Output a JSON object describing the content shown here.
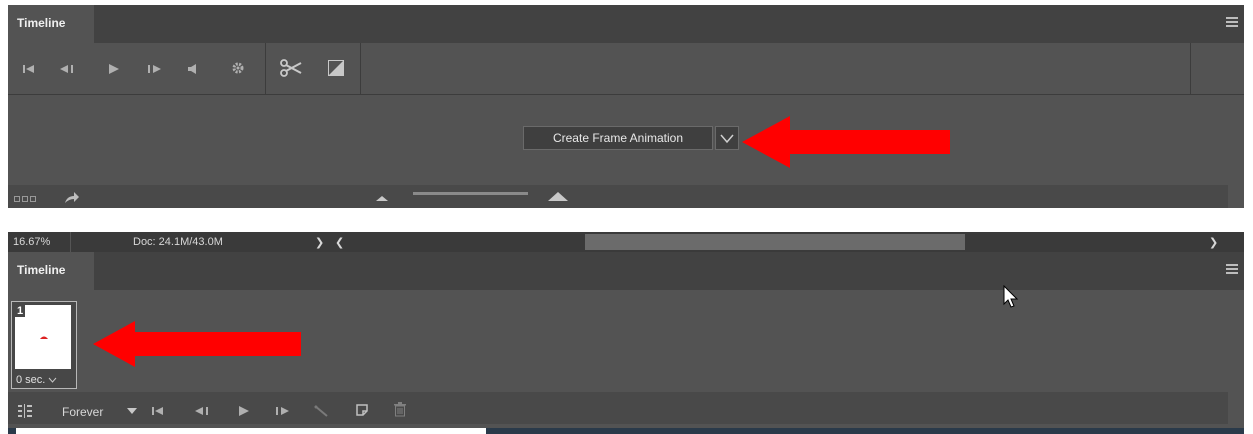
{
  "top_panel": {
    "tab_label": "Timeline",
    "create_button_label": "Create Frame Animation",
    "icons": [
      "go-to-first-frame-icon",
      "previous-frame-icon",
      "play-icon",
      "next-frame-icon",
      "audio-icon",
      "settings-icon",
      "split-at-playhead-icon",
      "transition-icon",
      "convert-icon",
      "render-icon",
      "zoom-out-icon",
      "zoom-in-icon",
      "dropdown-icon"
    ]
  },
  "status_bar": {
    "zoom": "16.67%",
    "doc_info": "Doc: 24.1M/43.0M",
    "nav_right": "❯",
    "nav_left": "❮",
    "nav_far_right": "❯"
  },
  "bottom_panel": {
    "tab_label": "Timeline",
    "frame": {
      "number": "1",
      "delay": "0 sec."
    },
    "loop_option": "Forever",
    "icons": [
      "convert-to-video-timeline-icon",
      "loop-dropdown-icon",
      "first-frame-icon",
      "previous-frame-icon",
      "play-icon",
      "next-frame-icon",
      "tween-icon",
      "new-frame-icon",
      "delete-icon"
    ]
  },
  "colors": {
    "panel": "#535353",
    "tabbar": "#424242",
    "annotation_arrow": "#ff0000"
  }
}
